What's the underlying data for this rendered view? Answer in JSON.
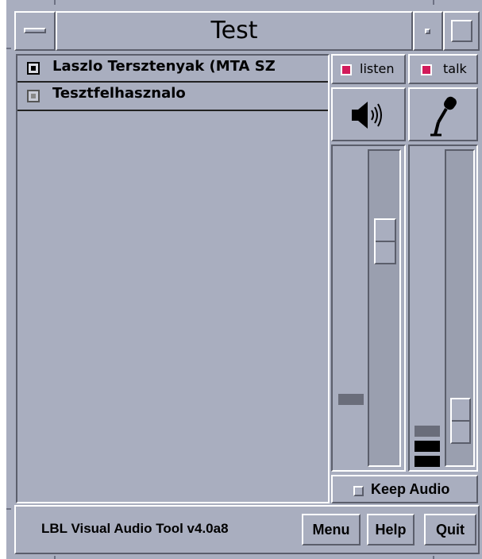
{
  "window": {
    "title": "Test"
  },
  "participants": [
    {
      "name": "Laszlo Tersztenyak (MTA SZ"
    },
    {
      "name": "Tesztfelhasznalo"
    }
  ],
  "listen": {
    "label": "listen",
    "checked": true
  },
  "talk": {
    "label": "talk",
    "checked": true
  },
  "speaker_volume": {
    "level": 0.75
  },
  "mic_gain": {
    "level": 0.08
  },
  "keep_audio": {
    "label": "Keep Audio",
    "checked": false
  },
  "status": {
    "text": "LBL Visual Audio Tool v4.0a8"
  },
  "buttons": {
    "menu": "Menu",
    "help": "Help",
    "quit": "Quit"
  },
  "colors": {
    "background": "#a9aebf",
    "check_on": "#d21a5a"
  },
  "icons": {
    "speaker": "speaker-icon",
    "microphone": "microphone-icon"
  }
}
